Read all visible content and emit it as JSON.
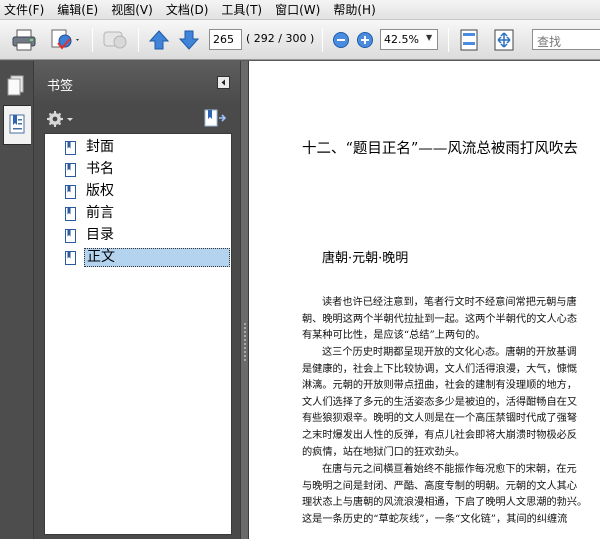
{
  "menu": {
    "items": [
      "文件(F)",
      "编辑(E)",
      "视图(V)",
      "文档(D)",
      "工具(T)",
      "窗口(W)",
      "帮助(H)"
    ]
  },
  "toolbar": {
    "page_current": "265",
    "page_count": "( 292 / 300 )",
    "zoom": "42.5%",
    "search_placeholder": "查找"
  },
  "panel": {
    "title": "书签"
  },
  "bookmarks": [
    "封面",
    "书名",
    "版权",
    "前言",
    "目录",
    "正文"
  ],
  "document": {
    "chapter_title": "十二、“题目正名”——风流总被雨打风吹去",
    "section_title": "唐朝·元朝·晚明",
    "paragraphs": [
      [
        "读者也许已经注意到，笔者行文时不经意间常把元朝与唐",
        "朝、晚明这两个半朝代拉扯到一起。这两个半朝代的文人心态",
        "有某种可比性，是应该“总结”上两句的。"
      ],
      [
        "这三个历史时期都呈现开放的文化心态。唐朝的开放基调",
        "是健康的，社会上下比较协调，文人们活得浪漫，大气，慷慨",
        "淋漓。元朝的开放则带点扭曲，社会的建制有没理顺的地方，",
        "文人们选择了多元的生活姿态多少是被迫的，活得酣畅自在又",
        "有些狼狈艰辛。晚明的文人则是在一个高压禁锢时代成了强弩",
        "之末时爆发出人性的反弹，有点儿社会即将大崩溃时物极必反",
        "的疯情，站在地狱门口的狂欢劲头。"
      ],
      [
        "在唐与元之间横亘着始终不能振作每况愈下的宋朝，在元",
        "与晚明之间是封闭、严酷、高度专制的明朝。元朝的文人其心",
        "理状态上与唐朝的风流浪漫相通，下启了晚明人文思潮的勃兴。",
        "这是一条历史的“草蛇灰线”，一条“文化链”，其间的纠缠流"
      ]
    ]
  }
}
